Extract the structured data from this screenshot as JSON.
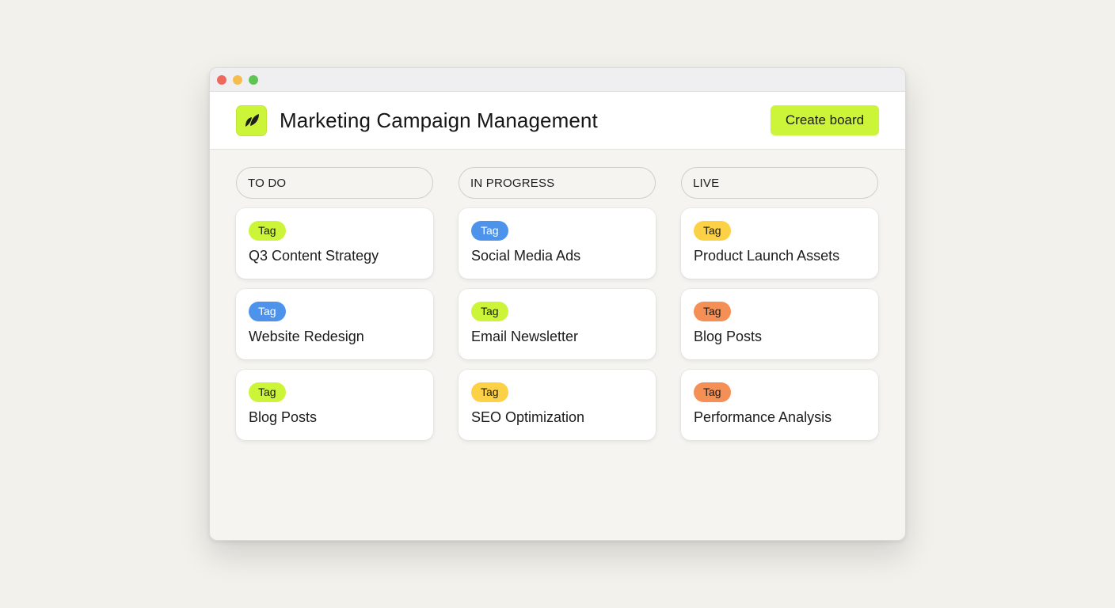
{
  "colors": {
    "accent": "#ccf53a",
    "tag_green": "#ccf53a",
    "tag_blue": "#4d93ec",
    "tag_yellow": "#fcd145",
    "tag_orange": "#f48f56",
    "light_red": "#ee6a5f",
    "light_yellow": "#f5bd4f",
    "light_green": "#5fc454"
  },
  "app": {
    "logo_icon": "leaf-icon",
    "title": "Marketing Campaign Management",
    "create_label": "Create board"
  },
  "columns": [
    {
      "label": "TO DO",
      "cards": [
        {
          "tag": "Tag",
          "tag_color": "green",
          "title": "Q3 Content Strategy"
        },
        {
          "tag": "Tag",
          "tag_color": "blue",
          "title": "Website Redesign"
        },
        {
          "tag": "Tag",
          "tag_color": "green",
          "title": "Blog Posts"
        }
      ]
    },
    {
      "label": "IN PROGRESS",
      "cards": [
        {
          "tag": "Tag",
          "tag_color": "blue",
          "title": "Social Media Ads"
        },
        {
          "tag": "Tag",
          "tag_color": "green",
          "title": "Email Newsletter"
        },
        {
          "tag": "Tag",
          "tag_color": "yellow",
          "title": "SEO Optimization"
        }
      ]
    },
    {
      "label": "LIVE",
      "cards": [
        {
          "tag": "Tag",
          "tag_color": "yellow",
          "title": "Product Launch Assets"
        },
        {
          "tag": "Tag",
          "tag_color": "orange",
          "title": "Blog Posts"
        },
        {
          "tag": "Tag",
          "tag_color": "orange",
          "title": "Performance Analysis"
        }
      ]
    }
  ]
}
